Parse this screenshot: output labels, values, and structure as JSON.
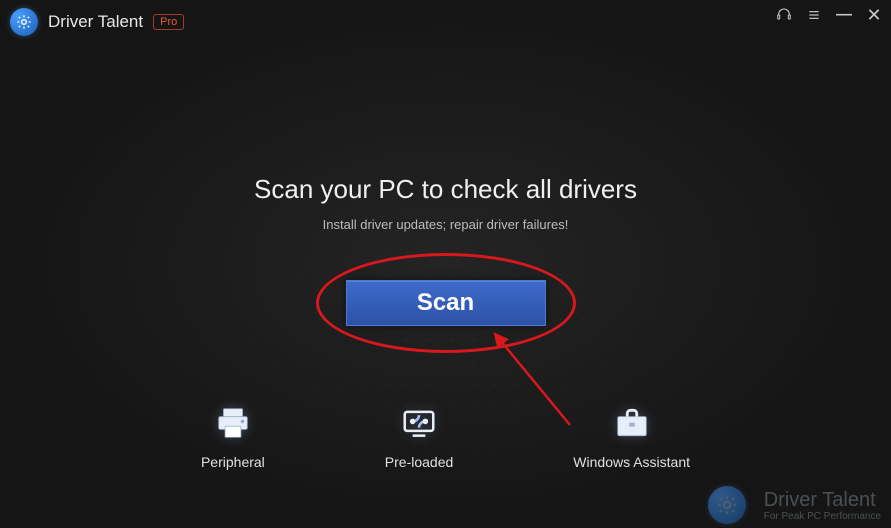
{
  "titlebar": {
    "app_name": "Driver Talent",
    "pro_label": "Pro"
  },
  "main": {
    "headline": "Scan your PC to check all drivers",
    "subline": "Install driver updates; repair driver failures!",
    "scan_button_label": "Scan"
  },
  "features": [
    {
      "label": "Peripheral",
      "icon": "printer-icon"
    },
    {
      "label": "Pre-loaded",
      "icon": "preloaded-icon"
    },
    {
      "label": "Windows Assistant",
      "icon": "briefcase-icon"
    }
  ],
  "watermark": {
    "title": "Driver Talent",
    "sub": "For Peak PC Performance"
  },
  "colors": {
    "accent": "#2d52a8",
    "annotation": "#d8181c"
  }
}
